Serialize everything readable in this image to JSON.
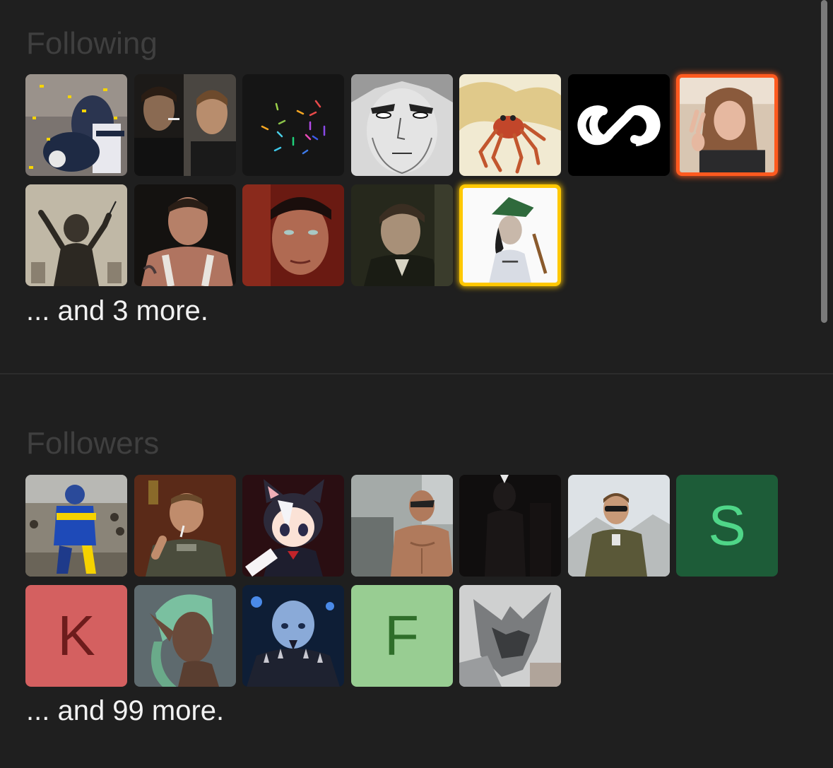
{
  "following": {
    "title": "Following",
    "more_text": "... and 3 more.",
    "avatars": [
      {
        "icon": "football-player-photo"
      },
      {
        "icon": "men-smoking-photo"
      },
      {
        "icon": "confetti-lines-logo"
      },
      {
        "icon": "manga-face-drawing"
      },
      {
        "icon": "crab-illustration"
      },
      {
        "icon": "infinity-logo"
      },
      {
        "icon": "girl-selfie-photo",
        "highlight": "#ff5a1f"
      },
      {
        "icon": "conductor-engraving"
      },
      {
        "icon": "muscular-man-photo"
      },
      {
        "icon": "man-portrait-red"
      },
      {
        "icon": "man-portrait-dark"
      },
      {
        "icon": "hunter-hat-figure",
        "highlight": "#ffc800"
      }
    ]
  },
  "followers": {
    "title": "Followers",
    "more_text": "... and 99 more.",
    "avatars": [
      {
        "icon": "racing-driver-photo"
      },
      {
        "icon": "officer-pipe-photo"
      },
      {
        "icon": "anime-catgirl-drawing"
      },
      {
        "icon": "shirtless-man-photo"
      },
      {
        "icon": "dark-figure-photo"
      },
      {
        "icon": "man-sunglasses-photo"
      },
      {
        "letter": "S",
        "bg": "#1d5c38",
        "fg": "#4fd688"
      },
      {
        "letter": "K",
        "bg": "#d46060",
        "fg": "#6e1c1c"
      },
      {
        "icon": "elf-3d-render"
      },
      {
        "icon": "blue-villain-render"
      },
      {
        "letter": "F",
        "bg": "#98cd92",
        "fg": "#2f6e2a"
      },
      {
        "icon": "wolf-drawing"
      }
    ]
  }
}
